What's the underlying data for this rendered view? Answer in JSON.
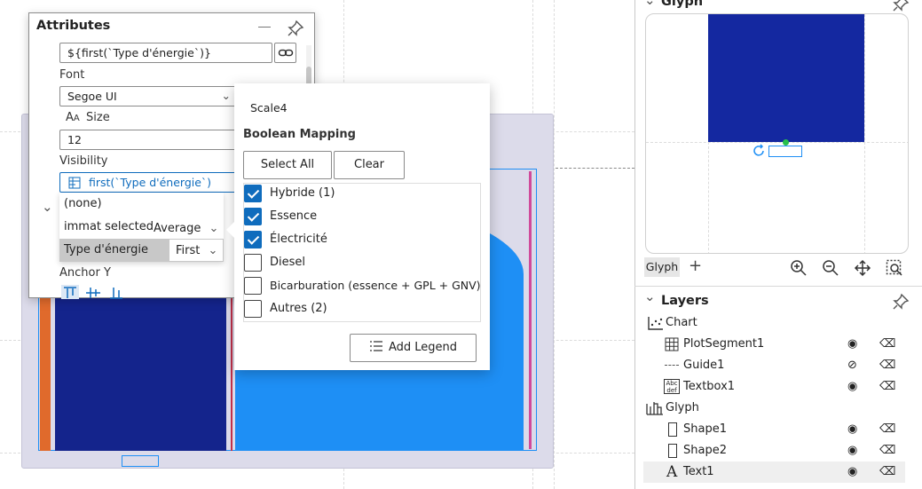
{
  "attributes_panel": {
    "title": "Attributes",
    "text_expression": "${first(`Type d'énergie`)}",
    "font_label": "Font",
    "font_value": "Segoe UI",
    "size_label": "Size",
    "size_value": "12",
    "visibility_label": "Visibility",
    "visibility_expression": "first(`Type d'énergie`)",
    "anchor_y_label": "Anchor Y"
  },
  "column_dropdown": {
    "items": [
      {
        "label": "(none)",
        "aggregation": ""
      },
      {
        "label": "immat selected",
        "aggregation": "Average"
      },
      {
        "label": "Type d'énergie",
        "aggregation": "First"
      }
    ]
  },
  "boolean_mapping": {
    "scale_name": "Scale4",
    "heading": "Boolean Mapping",
    "select_all_label": "Select All",
    "clear_label": "Clear",
    "options": [
      {
        "label": "Hybride (1)",
        "checked": true
      },
      {
        "label": "Essence",
        "checked": true
      },
      {
        "label": "Électricité",
        "checked": true
      },
      {
        "label": "Diesel",
        "checked": false
      },
      {
        "label": "Bicarburation (essence + GPL + GNV)",
        "checked": false
      },
      {
        "label": "Autres (2)",
        "checked": false
      }
    ],
    "add_legend_label": "Add Legend"
  },
  "glyph_panel": {
    "title": "Glyph",
    "tab_label": "Glyph",
    "glyph_color": "#1428a0"
  },
  "layers_panel": {
    "title": "Layers",
    "items": [
      {
        "label": "Chart",
        "icon": "scatter-chart-icon"
      },
      {
        "label": "PlotSegment1",
        "icon": "grid-icon"
      },
      {
        "label": "Guide1",
        "icon": "guide-dash-icon"
      },
      {
        "label": "Textbox1",
        "icon": "textbox-icon"
      },
      {
        "label": "Glyph",
        "icon": "glyph-icon"
      },
      {
        "label": "Shape1",
        "icon": "rect-shape-icon"
      },
      {
        "label": "Shape2",
        "icon": "rect-shape-icon"
      },
      {
        "label": "Text1",
        "icon": "text-a-icon"
      }
    ]
  },
  "canvas": {
    "colors": {
      "orange": "#e06a2c",
      "navy": "#14248c",
      "blue": "#1e8ff5",
      "background": "#dcdbea",
      "accent": "#0f6cbd"
    }
  }
}
